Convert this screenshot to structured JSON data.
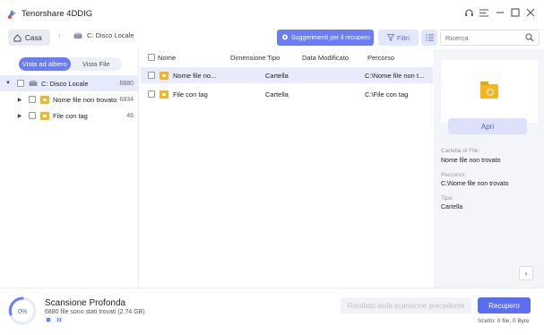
{
  "app": {
    "title": "Tenorshare 4DDIG"
  },
  "toolbar": {
    "home_label": "Casa",
    "path": "C: Disco Locale",
    "suggestions_label": "Suggerimenti per il recupero",
    "filter_label": "Filtri",
    "search_placeholder": "Ricerca"
  },
  "sidebar": {
    "tabs": [
      {
        "label": "Vista ad albero",
        "active": true
      },
      {
        "label": "Vista File",
        "active": false
      }
    ],
    "tree": [
      {
        "label": "C: Disco Locale",
        "count": "6880"
      },
      {
        "label": "Nome file non trovato",
        "count": "6834"
      },
      {
        "label": "File con tag",
        "count": "46"
      }
    ]
  },
  "filelist": {
    "columns": [
      "Nome",
      "Dimensione",
      "Tipo",
      "Data Modificato",
      "Percorso"
    ],
    "rows": [
      {
        "name": "Nome file no...",
        "size": "",
        "type": "Cartella",
        "date": "",
        "path": "C:\\Nome file non t..."
      },
      {
        "name": "File con tag",
        "size": "",
        "type": "Cartella",
        "date": "",
        "path": "C:\\File con tag"
      }
    ]
  },
  "details": {
    "open_label": "Apri",
    "folder_label": "Cartella di File:",
    "folder_value": "Nome file non trovato",
    "path_label": "Percorso:",
    "path_value": "C:\\Nome file non trovato",
    "type_label": "Tipo:",
    "type_value": "Cartella"
  },
  "bottom": {
    "progress": "0%",
    "scan_title": "Scansione Profonda",
    "scan_sub": "6880 file sono stati trovati (2.74 GB)",
    "prev_result_label": "Risultato della scansione precedente",
    "recover_label": "Recupero",
    "selection_info": "Scelto: 0 file, 0 Byte"
  },
  "colors": {
    "accent": "#5b6ef0",
    "folder": "#f5b521",
    "selected_row": "#e7ebfb"
  }
}
